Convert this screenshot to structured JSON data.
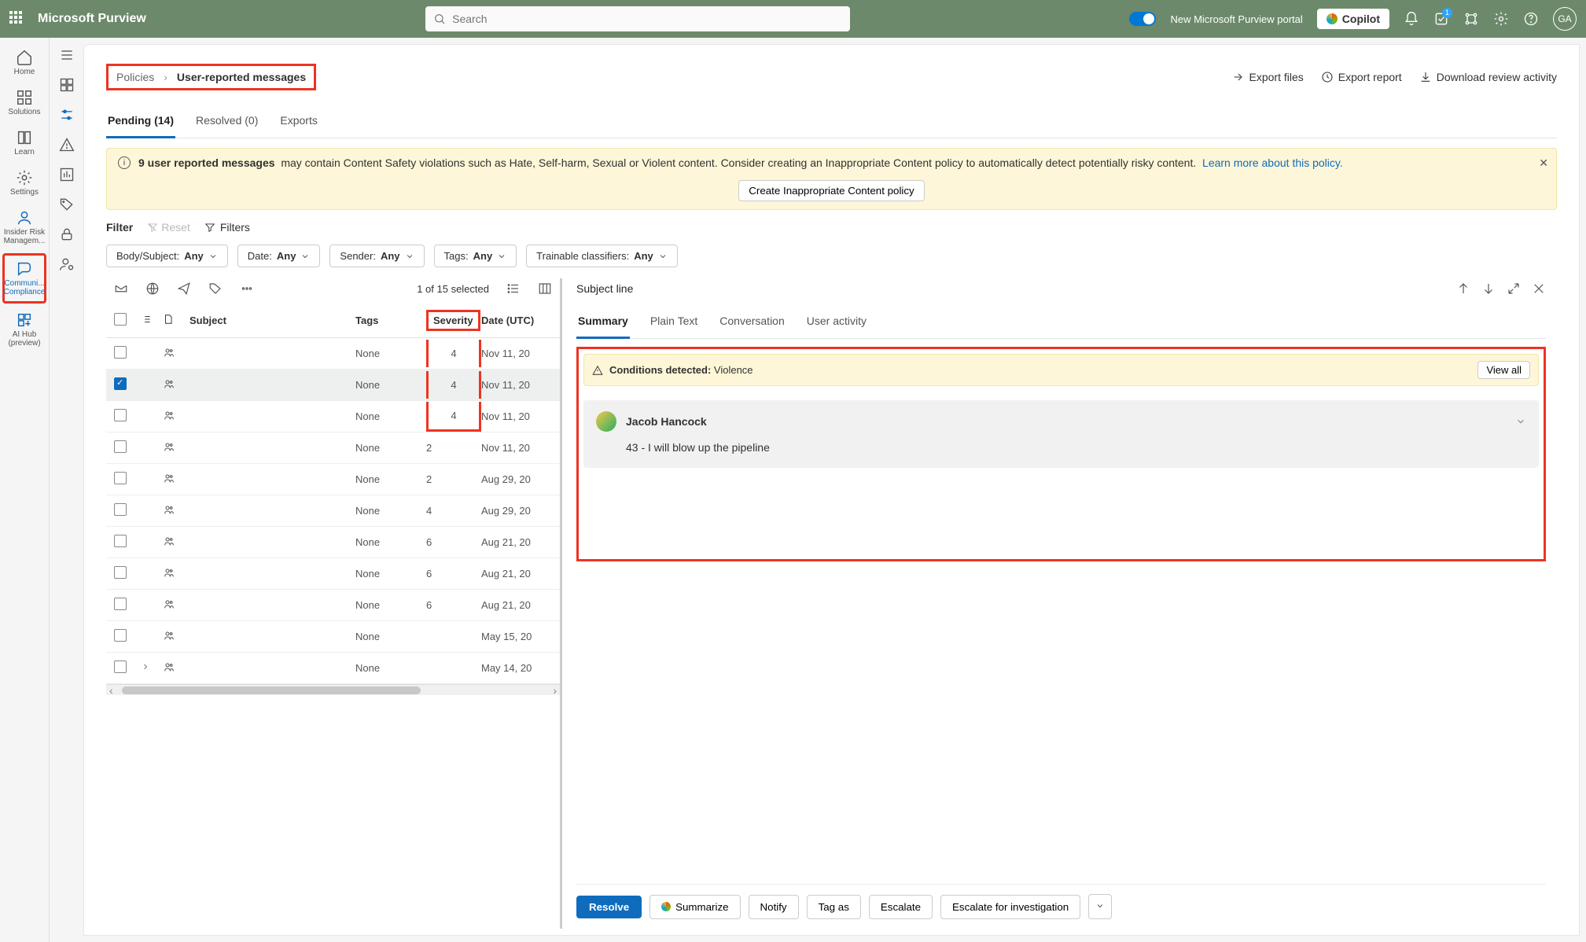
{
  "app_title": "Microsoft Purview",
  "search_placeholder": "Search",
  "top": {
    "toggle_label": "New Microsoft Purview portal",
    "copilot": "Copilot",
    "badge": "1",
    "avatar": "GA"
  },
  "rail": [
    {
      "label": "Home"
    },
    {
      "label": "Solutions"
    },
    {
      "label": "Learn"
    },
    {
      "label": "Settings"
    },
    {
      "label": "Insider Risk Managem..."
    },
    {
      "label": "Communi... Compliance"
    },
    {
      "label": "AI Hub (preview)"
    }
  ],
  "breadcrumb": {
    "root": "Policies",
    "leaf": "User-reported messages"
  },
  "page_actions": {
    "export_files": "Export files",
    "export_report": "Export report",
    "download": "Download review activity"
  },
  "tabs": [
    {
      "label": "Pending (14)"
    },
    {
      "label": "Resolved (0)"
    },
    {
      "label": "Exports"
    }
  ],
  "banner": {
    "bold": "9 user reported messages",
    "text": "may contain Content Safety violations such as Hate, Self-harm, Sexual or Violent content. Consider creating an Inappropriate Content policy to automatically detect potentially risky content.",
    "learn": "Learn more about this policy.",
    "button": "Create Inappropriate Content policy"
  },
  "filter_bar": {
    "filter": "Filter",
    "reset": "Reset",
    "filters": "Filters"
  },
  "pills": [
    {
      "label": "Body/Subject:",
      "value": "Any"
    },
    {
      "label": "Date:",
      "value": "Any"
    },
    {
      "label": "Sender:",
      "value": "Any"
    },
    {
      "label": "Tags:",
      "value": "Any"
    },
    {
      "label": "Trainable classifiers:",
      "value": "Any"
    }
  ],
  "toolbar": {
    "selected": "1 of 15 selected"
  },
  "columns": {
    "subject": "Subject",
    "tags": "Tags",
    "severity": "Severity",
    "date": "Date (UTC)"
  },
  "rows": [
    {
      "checked": false,
      "tags": "None",
      "severity": "4",
      "date": "Nov 11, 20"
    },
    {
      "checked": true,
      "tags": "None",
      "severity": "4",
      "date": "Nov 11, 20"
    },
    {
      "checked": false,
      "tags": "None",
      "severity": "4",
      "date": "Nov 11, 20"
    },
    {
      "checked": false,
      "tags": "None",
      "severity": "2",
      "date": "Nov 11, 20"
    },
    {
      "checked": false,
      "tags": "None",
      "severity": "2",
      "date": "Aug 29, 20"
    },
    {
      "checked": false,
      "tags": "None",
      "severity": "4",
      "date": "Aug 29, 20"
    },
    {
      "checked": false,
      "tags": "None",
      "severity": "6",
      "date": "Aug 21, 20"
    },
    {
      "checked": false,
      "tags": "None",
      "severity": "6",
      "date": "Aug 21, 20"
    },
    {
      "checked": false,
      "tags": "None",
      "severity": "6",
      "date": "Aug 21, 20"
    },
    {
      "checked": false,
      "tags": "None",
      "severity": "",
      "date": "May 15, 20"
    },
    {
      "checked": false,
      "expand": true,
      "tags": "None",
      "severity": "",
      "date": "May 14, 20"
    }
  ],
  "detail": {
    "title": "Subject line",
    "tabs": [
      "Summary",
      "Plain Text",
      "Conversation",
      "User activity"
    ],
    "conditions_label": "Conditions detected:",
    "conditions_value": "Violence",
    "view_all": "View all",
    "sender": "Jacob Hancock",
    "message": "43 - I will blow up the pipeline",
    "actions": {
      "resolve": "Resolve",
      "summarize": "Summarize",
      "notify": "Notify",
      "tag_as": "Tag as",
      "escalate": "Escalate",
      "escalate_inv": "Escalate for investigation"
    }
  }
}
